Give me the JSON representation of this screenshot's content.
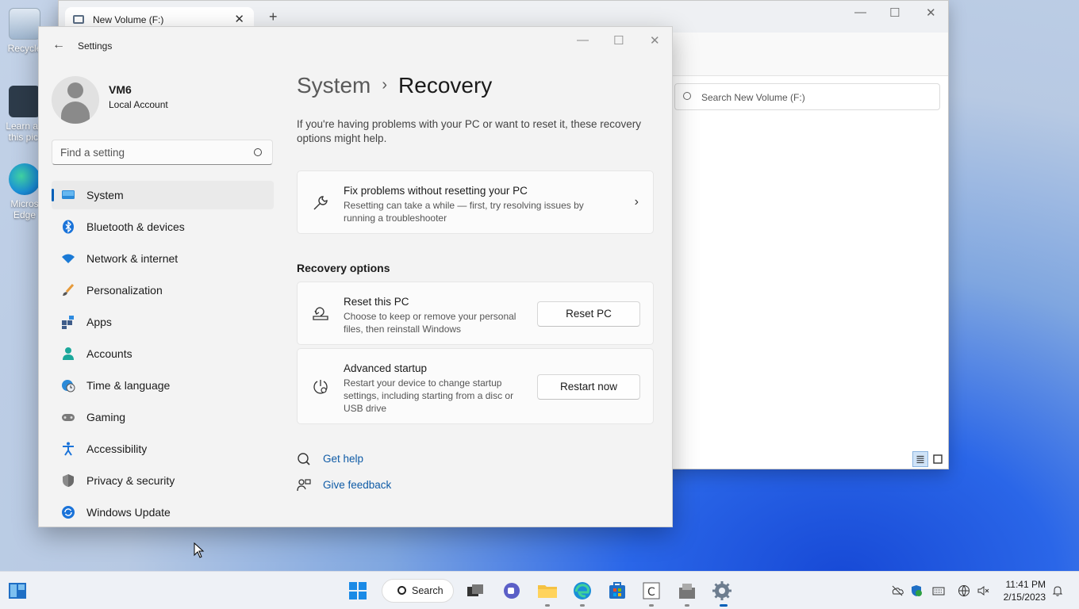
{
  "desktop": {
    "icons": [
      {
        "label": "Recycle",
        "icon": "recycle-bin-icon"
      },
      {
        "label": "Learn ab this pict",
        "icon": "camera-icon"
      },
      {
        "label": "Micros Edge",
        "icon": "edge-icon"
      }
    ]
  },
  "explorer": {
    "tab_title": "New Volume (F:)",
    "search_placeholder": "Search New Volume (F:)"
  },
  "settings": {
    "window_title": "Settings",
    "profile": {
      "name": "VM6",
      "account": "Local Account"
    },
    "search_placeholder": "Find a setting",
    "nav": [
      {
        "label": "System",
        "icon": "system-icon",
        "active": true
      },
      {
        "label": "Bluetooth & devices",
        "icon": "bluetooth-icon"
      },
      {
        "label": "Network & internet",
        "icon": "wifi-icon"
      },
      {
        "label": "Personalization",
        "icon": "brush-icon"
      },
      {
        "label": "Apps",
        "icon": "apps-icon"
      },
      {
        "label": "Accounts",
        "icon": "accounts-icon"
      },
      {
        "label": "Time & language",
        "icon": "globe-clock-icon"
      },
      {
        "label": "Gaming",
        "icon": "gamepad-icon"
      },
      {
        "label": "Accessibility",
        "icon": "accessibility-icon"
      },
      {
        "label": "Privacy & security",
        "icon": "shield-icon"
      },
      {
        "label": "Windows Update",
        "icon": "update-icon"
      }
    ],
    "breadcrumb": {
      "parent": "System",
      "separator": "›",
      "current": "Recovery"
    },
    "intro": "If you're having problems with your PC or want to reset it, these recovery options might help.",
    "fix_card": {
      "title": "Fix problems without resetting your PC",
      "desc": "Resetting can take a while — first, try resolving issues by running a troubleshooter"
    },
    "section_title": "Recovery options",
    "reset_card": {
      "title": "Reset this PC",
      "desc": "Choose to keep or remove your personal files, then reinstall Windows",
      "button": "Reset PC"
    },
    "advanced_card": {
      "title": "Advanced startup",
      "desc": "Restart your device to change startup settings, including starting from a disc or USB drive",
      "button": "Restart now"
    },
    "links": {
      "help": "Get help",
      "feedback": "Give feedback"
    }
  },
  "taskbar": {
    "search_label": "Search",
    "time": "11:41 PM",
    "date": "2/15/2023"
  },
  "colors": {
    "accent": "#005fb8",
    "link": "#0f5ba6"
  }
}
